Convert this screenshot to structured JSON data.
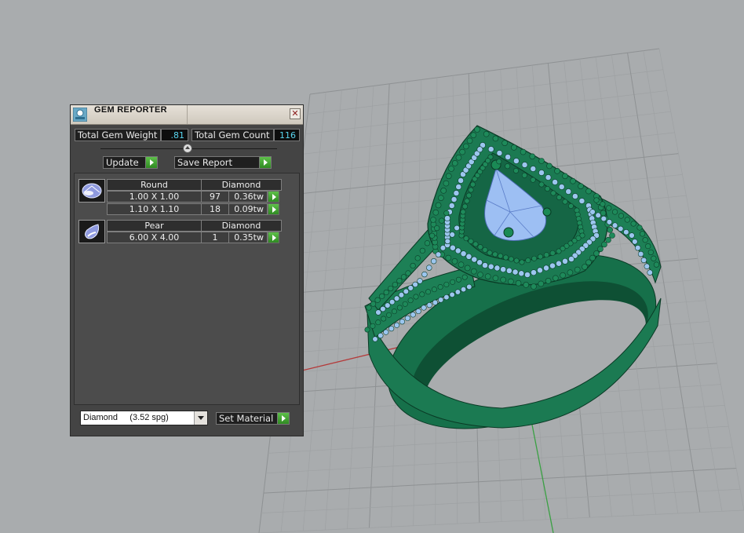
{
  "panel": {
    "title": "GEM REPORTER",
    "close_glyph": "✕",
    "total_weight_label": "Total Gem Weight",
    "total_weight_value": ".81",
    "total_count_label": "Total Gem Count",
    "total_count_value": "116",
    "update_label": "Update",
    "save_report_label": "Save Report",
    "groups": [
      {
        "shape": "Round",
        "material": "Diamond",
        "icon": "round-gem-icon",
        "rows": [
          {
            "size": "1.00 X 1.00",
            "count": "97",
            "weight": "0.36tw"
          },
          {
            "size": "1.10 X 1.10",
            "count": "18",
            "weight": "0.09tw"
          }
        ]
      },
      {
        "shape": "Pear",
        "material": "Diamond",
        "icon": "pear-gem-icon",
        "rows": [
          {
            "size": "6.00 X 4.00",
            "count": "1",
            "weight": "0.35tw"
          }
        ]
      }
    ],
    "material_select_value": "Diamond     (3.52 spg)",
    "set_material_label": "Set Material"
  },
  "colors": {
    "ring_green": "#1b7a52",
    "gem_blue": "#8ab8ee",
    "viewport_bg": "#a9acae",
    "value_cyan": "#58d6f0"
  }
}
